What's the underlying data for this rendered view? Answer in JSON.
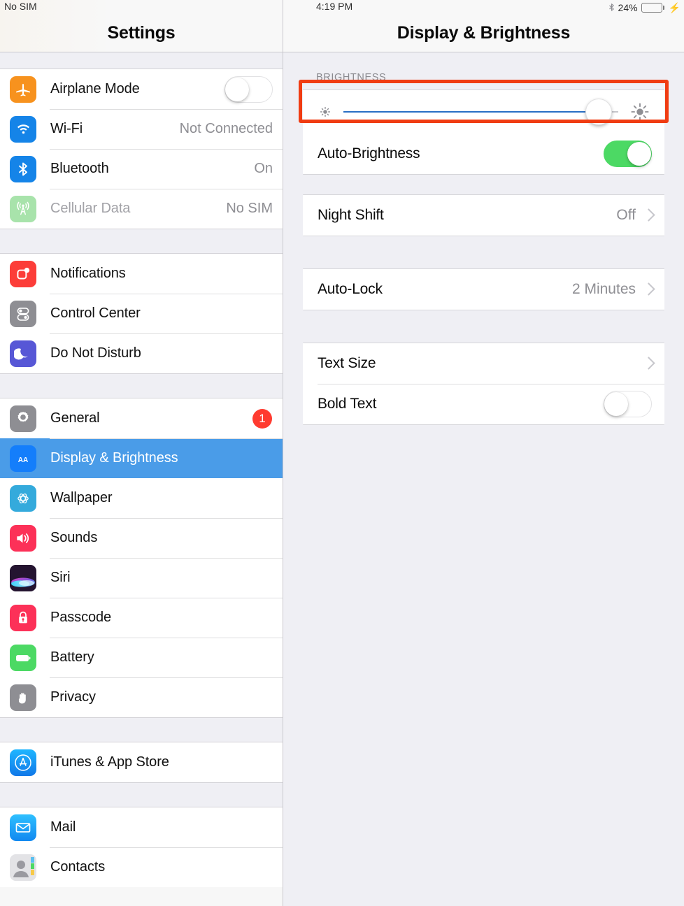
{
  "status_bar": {
    "carrier": "No SIM",
    "time": "4:19 PM",
    "bluetooth_icon": "bluetooth-icon",
    "battery_percent": "24%",
    "battery_level": 24,
    "charging_icon": "charging-bolt-icon"
  },
  "sidebar": {
    "title": "Settings",
    "groups": [
      {
        "items": [
          {
            "label": "Airplane Mode",
            "icon": "airplane-icon",
            "icon_color": "#f7921e",
            "control": "toggle",
            "toggle_on": false
          },
          {
            "label": "Wi-Fi",
            "icon": "wifi-icon",
            "icon_color": "#1584e8",
            "value": "Not Connected"
          },
          {
            "label": "Bluetooth",
            "icon": "bluetooth-icon",
            "icon_color": "#1584e8",
            "value": "On"
          },
          {
            "label": "Cellular Data",
            "icon": "cellular-icon",
            "icon_color": "#a8e3ab",
            "value": "No SIM",
            "disabled": true
          }
        ]
      },
      {
        "items": [
          {
            "label": "Notifications",
            "icon": "notifications-icon",
            "icon_color": "#fc3d39"
          },
          {
            "label": "Control Center",
            "icon": "control-center-icon",
            "icon_color": "#8e8e93"
          },
          {
            "label": "Do Not Disturb",
            "icon": "do-not-disturb-icon",
            "icon_color": "#5757d6"
          }
        ]
      },
      {
        "items": [
          {
            "label": "General",
            "icon": "gear-icon",
            "icon_color": "#8e8e93",
            "badge": "1"
          },
          {
            "label": "Display & Brightness",
            "icon": "text-size-aa-icon",
            "icon_color": "#147efb",
            "selected": true
          },
          {
            "label": "Wallpaper",
            "icon": "wallpaper-flower-icon",
            "icon_color": "#34aadc"
          },
          {
            "label": "Sounds",
            "icon": "speaker-icon",
            "icon_color": "#fc3158"
          },
          {
            "label": "Siri",
            "icon": "siri-icon",
            "icon_color": "#2b1a38"
          },
          {
            "label": "Passcode",
            "icon": "lock-icon",
            "icon_color": "#fc3158"
          },
          {
            "label": "Battery",
            "icon": "battery-icon",
            "icon_color": "#4cd964"
          },
          {
            "label": "Privacy",
            "icon": "hand-icon",
            "icon_color": "#8e8e93"
          }
        ]
      },
      {
        "items": [
          {
            "label": "iTunes & App Store",
            "icon": "app-store-icon",
            "icon_color": "#1a9cf0"
          }
        ]
      },
      {
        "items": [
          {
            "label": "Mail",
            "icon": "mail-envelope-icon",
            "icon_color": "#1a9cf0"
          },
          {
            "label": "Contacts",
            "icon": "contacts-icon",
            "icon_color": "#d8d8dc"
          }
        ]
      }
    ]
  },
  "detail": {
    "title": "Display & Brightness",
    "brightness_section": {
      "header": "BRIGHTNESS",
      "slider": {
        "name": "brightness-slider",
        "value_percent": 93,
        "low_icon": "sun-small-icon",
        "high_icon": "sun-large-icon"
      },
      "auto_brightness": {
        "label": "Auto-Brightness",
        "toggle_on": true
      }
    },
    "night_shift": {
      "label": "Night Shift",
      "value": "Off",
      "chevron": "chevron-right-icon"
    },
    "auto_lock": {
      "label": "Auto-Lock",
      "value": "2 Minutes",
      "chevron": "chevron-right-icon",
      "highlighted": true
    },
    "text_size": {
      "label": "Text Size",
      "chevron": "chevron-right-icon"
    },
    "bold_text": {
      "label": "Bold Text",
      "toggle_on": false
    }
  },
  "colors": {
    "selection_blue": "#4a9ce8",
    "highlight_red": "#f03c12",
    "toggle_green": "#4cd964",
    "badge_red": "#ff3b30",
    "panel_bg": "#efeff4"
  }
}
